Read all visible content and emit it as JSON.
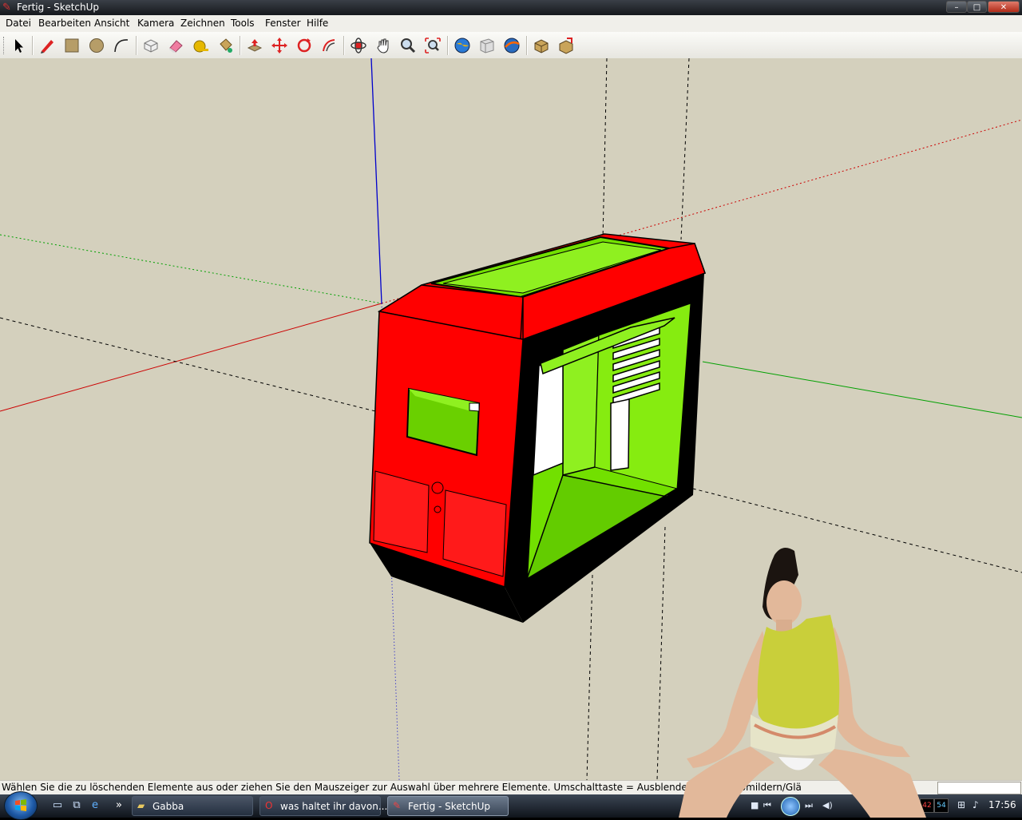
{
  "window": {
    "title": "Fertig - SketchUp",
    "controls": {
      "minimize": "–",
      "maximize": "□",
      "close": "✕"
    }
  },
  "menu": [
    "Datei",
    "Bearbeiten",
    "Ansicht",
    "Kamera",
    "Zeichnen",
    "Tools",
    "Fenster",
    "Hilfe"
  ],
  "toolbar": {
    "tools": [
      "select-tool-icon",
      "pencil-line-icon",
      "rectangle-icon",
      "circle-icon",
      "arc-icon",
      "make-component-icon",
      "eraser-icon",
      "tape-measure-icon",
      "paint-bucket-icon",
      "push-pull-icon",
      "move-icon",
      "rotate-icon",
      "follow-me-icon",
      "orbit-icon",
      "pan-icon",
      "zoom-icon",
      "zoom-extents-icon",
      "get-models-icon",
      "share-model-icon",
      "google-earth-icon",
      "components-icon",
      "share-component-icon"
    ]
  },
  "colors": {
    "case_red": "#ff0000",
    "case_green": "#72e000",
    "case_green_dark": "#52b800",
    "case_black": "#000000",
    "background": "#d4d0bd",
    "axis_red": "#cc0000",
    "axis_green": "#00a000",
    "axis_blue": "#0000cc"
  },
  "statusbar": {
    "text": "Wählen Sie die zu löschenden Elemente aus oder ziehen Sie den Mauszeiger zur Auswahl über mehrere Elemente. Umschalttaste = Ausblenden, Strg = Abmildern/Glä",
    "measurements": ""
  },
  "taskbar": {
    "quicklaunch_more": "»",
    "tasks": [
      {
        "label": "Gabba",
        "icon": "folder-icon"
      },
      {
        "label": "was haltet ihr davon...",
        "icon": "opera-icon"
      },
      {
        "label": "Fertig - SketchUp",
        "icon": "sketchup-icon"
      }
    ],
    "tray": {
      "cpu1": "42",
      "cpu2": "54",
      "clock": "17:56"
    }
  }
}
